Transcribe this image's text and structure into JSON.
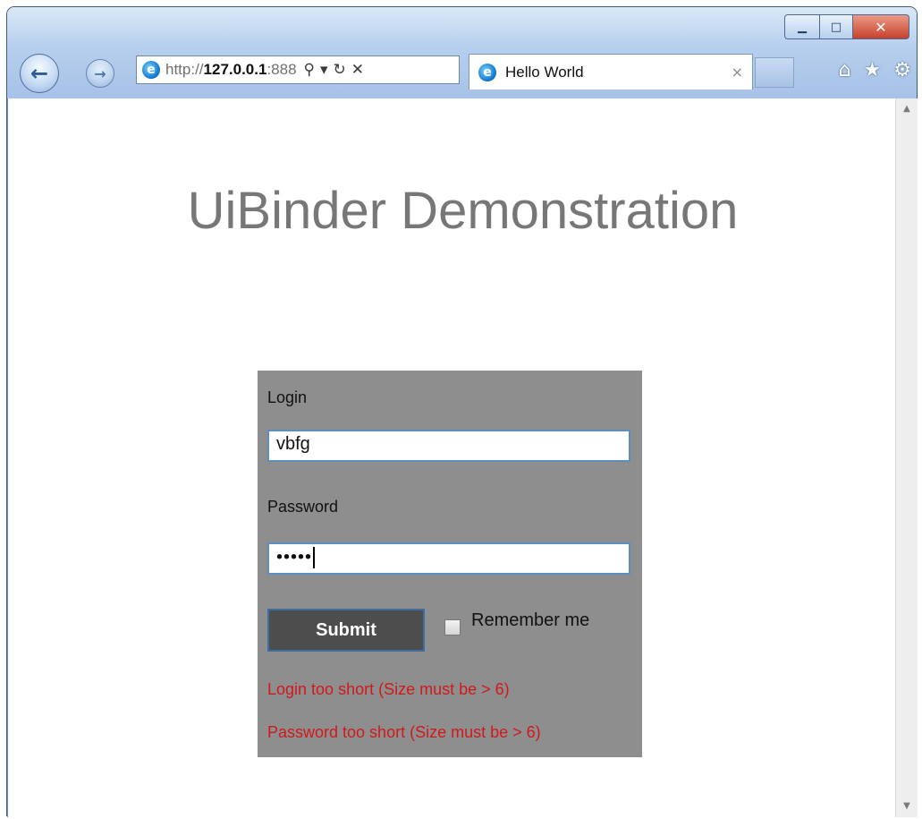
{
  "browser": {
    "address": {
      "protocol": "http://",
      "host": "127.0.0.1",
      "port_fragment": ":888"
    },
    "address_tools": {
      "search": "⚲",
      "dropdown": "▾",
      "refresh": "↻",
      "stop": "✕"
    },
    "tab": {
      "title": "Hello World",
      "close": "×"
    },
    "window_controls": {
      "minimize": "▁",
      "maximize": "□",
      "close": "✕"
    },
    "nav": {
      "back": "←",
      "forward": "→"
    },
    "command_icons": {
      "home": "⌂",
      "favorites": "★",
      "tools": "⚙"
    }
  },
  "page": {
    "heading": "UiBinder Demonstration",
    "form": {
      "login_label": "Login",
      "login_value": "vbfg",
      "password_label": "Password",
      "password_value": "•••••",
      "submit_label": "Submit",
      "remember_label": "Remember me",
      "remember_checked": false,
      "errors": {
        "login": "Login too short (Size must be > 6)",
        "password": "Password too short (Size must be > 6)"
      }
    }
  },
  "colors": {
    "panel_bg": "#8e8e8e",
    "heading": "#777777",
    "error": "#d0191c",
    "submit_bg": "#4d4d4d"
  }
}
